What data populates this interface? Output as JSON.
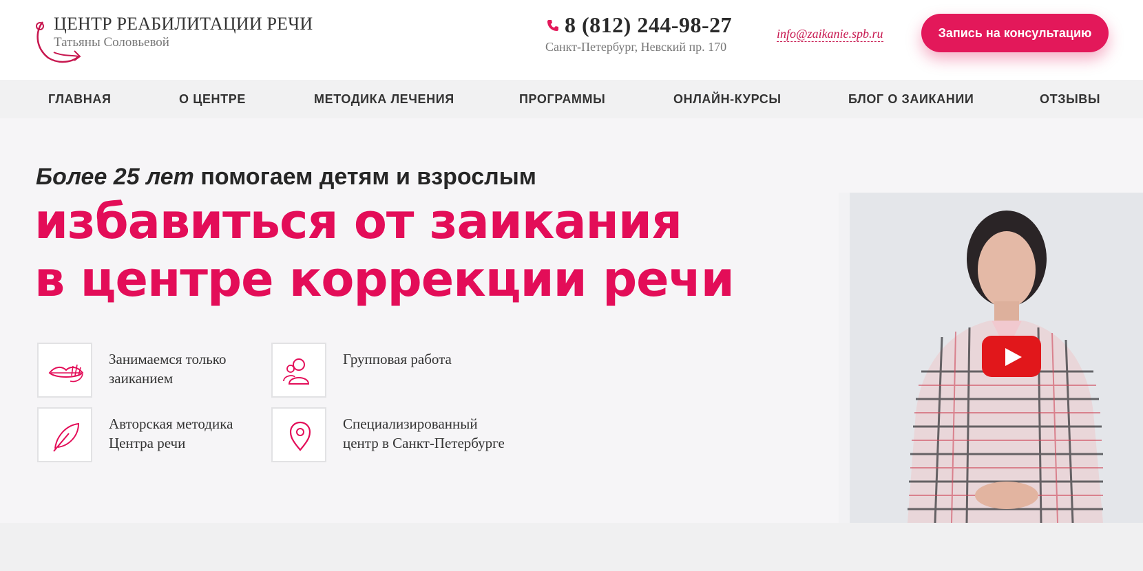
{
  "logo": {
    "title": "ЦЕНТР РЕАБИЛИТАЦИИ РЕЧИ",
    "subtitle": "Татьяны Соловьевой"
  },
  "contacts": {
    "phone": "8 (812) 244-98-27",
    "address": "Санкт-Петербург, Невский пр. 170",
    "email": "info@zaikanie.spb.ru"
  },
  "cta": {
    "label": "Запись на консультацию"
  },
  "nav": {
    "items": [
      {
        "label": "ГЛАВНАЯ"
      },
      {
        "label": "О ЦЕНТРЕ"
      },
      {
        "label": "МЕТОДИКА ЛЕЧЕНИЯ"
      },
      {
        "label": "ПРОГРАММЫ"
      },
      {
        "label": "ОНЛАЙН-КУРСЫ"
      },
      {
        "label": "БЛОГ О ЗАИКАНИИ"
      },
      {
        "label": "ОТЗЫВЫ"
      }
    ]
  },
  "hero": {
    "tagline_em": "Более 25 лет",
    "tagline_rest": " помогаем детям и взрослым",
    "headline_line1": "избавиться от заикания",
    "headline_line2": "в центре коррекции речи"
  },
  "features": [
    {
      "icon": "lips-hand-icon",
      "line1": "Занимаемся только",
      "line2": "заиканием"
    },
    {
      "icon": "group-people-icon",
      "line1": "Групповая работа",
      "line2": ""
    },
    {
      "icon": "feather-icon",
      "line1": "Авторская методика",
      "line2": "Центра речи"
    },
    {
      "icon": "location-pin-icon",
      "line1": "Специализированный",
      "line2": "центр в Санкт-Петербурге"
    }
  ],
  "video": {
    "play_icon": "youtube-play-icon"
  },
  "colors": {
    "accent": "#e30d58",
    "button": "#e3185a",
    "play": "#e1171b"
  }
}
